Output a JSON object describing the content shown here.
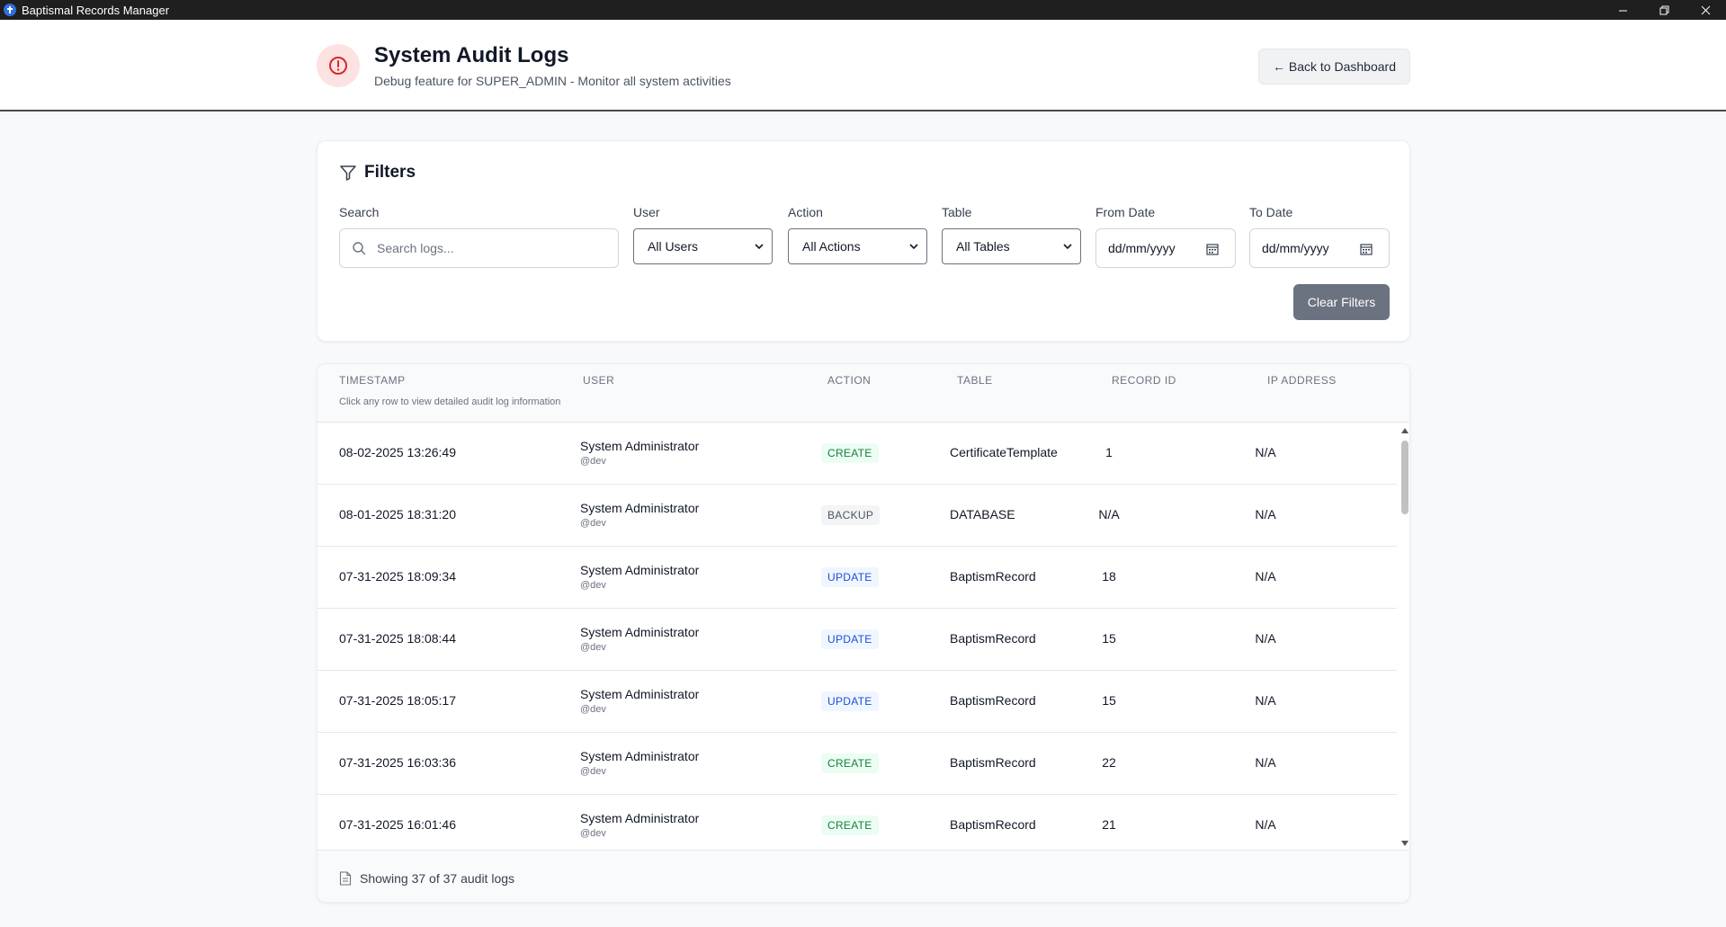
{
  "window": {
    "title": "Baptismal Records Manager"
  },
  "header": {
    "title": "System Audit Logs",
    "subtitle": "Debug feature for SUPER_ADMIN - Monitor all system activities",
    "back_label": "← Back to Dashboard"
  },
  "filters": {
    "title": "Filters",
    "search": {
      "label": "Search",
      "placeholder": "Search logs..."
    },
    "user": {
      "label": "User",
      "value": "All Users"
    },
    "action": {
      "label": "Action",
      "value": "All Actions"
    },
    "table": {
      "label": "Table",
      "value": "All Tables"
    },
    "from_date": {
      "label": "From Date",
      "value": "dd/mm/yyyy"
    },
    "to_date": {
      "label": "To Date",
      "value": "dd/mm/yyyy"
    },
    "clear_label": "Clear Filters"
  },
  "table": {
    "columns": [
      "TIMESTAMP",
      "USER",
      "ACTION",
      "TABLE",
      "RECORD ID",
      "IP ADDRESS"
    ],
    "hint": "Click any row to view detailed audit log information",
    "rows": [
      {
        "timestamp": "08-02-2025 13:26:49",
        "user": "System Administrator",
        "handle": "@dev",
        "action": "CREATE",
        "table": "CertificateTemplate",
        "record_id": "1",
        "ip": "N/A"
      },
      {
        "timestamp": "08-01-2025 18:31:20",
        "user": "System Administrator",
        "handle": "@dev",
        "action": "BACKUP",
        "table": "DATABASE",
        "record_id": "N/A",
        "ip": "N/A"
      },
      {
        "timestamp": "07-31-2025 18:09:34",
        "user": "System Administrator",
        "handle": "@dev",
        "action": "UPDATE",
        "table": "BaptismRecord",
        "record_id": "18",
        "ip": "N/A"
      },
      {
        "timestamp": "07-31-2025 18:08:44",
        "user": "System Administrator",
        "handle": "@dev",
        "action": "UPDATE",
        "table": "BaptismRecord",
        "record_id": "15",
        "ip": "N/A"
      },
      {
        "timestamp": "07-31-2025 18:05:17",
        "user": "System Administrator",
        "handle": "@dev",
        "action": "UPDATE",
        "table": "BaptismRecord",
        "record_id": "15",
        "ip": "N/A"
      },
      {
        "timestamp": "07-31-2025 16:03:36",
        "user": "System Administrator",
        "handle": "@dev",
        "action": "CREATE",
        "table": "BaptismRecord",
        "record_id": "22",
        "ip": "N/A"
      },
      {
        "timestamp": "07-31-2025 16:01:46",
        "user": "System Administrator",
        "handle": "@dev",
        "action": "CREATE",
        "table": "BaptismRecord",
        "record_id": "21",
        "ip": "N/A"
      }
    ],
    "footer": "Showing 37 of 37 audit logs"
  },
  "colors": {
    "alert_red": "#dc2626",
    "alert_bg": "#fde2e2",
    "create_green": "#15803d",
    "update_blue": "#1d4ed8",
    "clear_button": "#6b7280"
  }
}
